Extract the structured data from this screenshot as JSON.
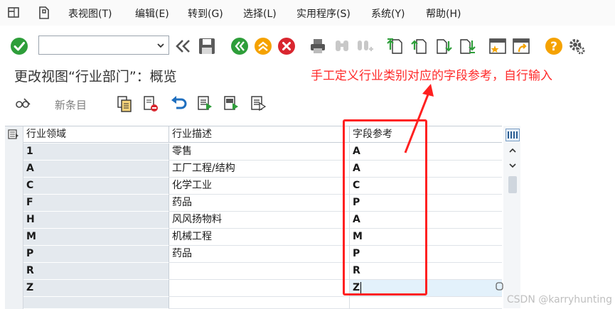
{
  "menubar": {
    "items": [
      "表视图(T)",
      "编辑(E)",
      "转到(G)",
      "选择(L)",
      "实用程序(S)",
      "系统(Y)",
      "帮助(H)"
    ]
  },
  "toolbar": {
    "command_field_value": "",
    "icons": [
      "check-icon",
      "back-double-chevron-icon",
      "save-icon",
      "back-icon",
      "exit-icon",
      "cancel-icon",
      "print-icon",
      "find-icon",
      "find-next-icon",
      "first-page-icon",
      "prev-page-icon",
      "next-page-icon",
      "last-page-icon",
      "new-session-icon",
      "shortcut-icon",
      "help-icon",
      "settings-icon"
    ]
  },
  "page": {
    "title": "更改视图“行业部门”：概览",
    "annotation": "手工定义行业类别对应的字段参考，自行输入",
    "new_entry_label": "新条目"
  },
  "table": {
    "columns": [
      "行业领域",
      "行业描述",
      "字段参考"
    ],
    "rows": [
      {
        "code": "1",
        "desc": "零售",
        "ref": "A"
      },
      {
        "code": "A",
        "desc": "工厂工程/结构",
        "ref": "A"
      },
      {
        "code": "C",
        "desc": "化学工业",
        "ref": "C"
      },
      {
        "code": "F",
        "desc": "药品",
        "ref": "P"
      },
      {
        "code": "H",
        "desc": "风风扬物料",
        "ref": "A"
      },
      {
        "code": "M",
        "desc": "机械工程",
        "ref": "M"
      },
      {
        "code": "P",
        "desc": "药品",
        "ref": "P"
      },
      {
        "code": "R",
        "desc": "",
        "ref": "R"
      },
      {
        "code": "Z",
        "desc": "",
        "ref": "Z"
      }
    ]
  },
  "colors": {
    "annotation": "#ff2a2a",
    "ok_green": "#2e9e3a",
    "nav_orange": "#f5a200",
    "cancel_red": "#d9262f"
  },
  "watermark": "CSDN @karryhunting"
}
